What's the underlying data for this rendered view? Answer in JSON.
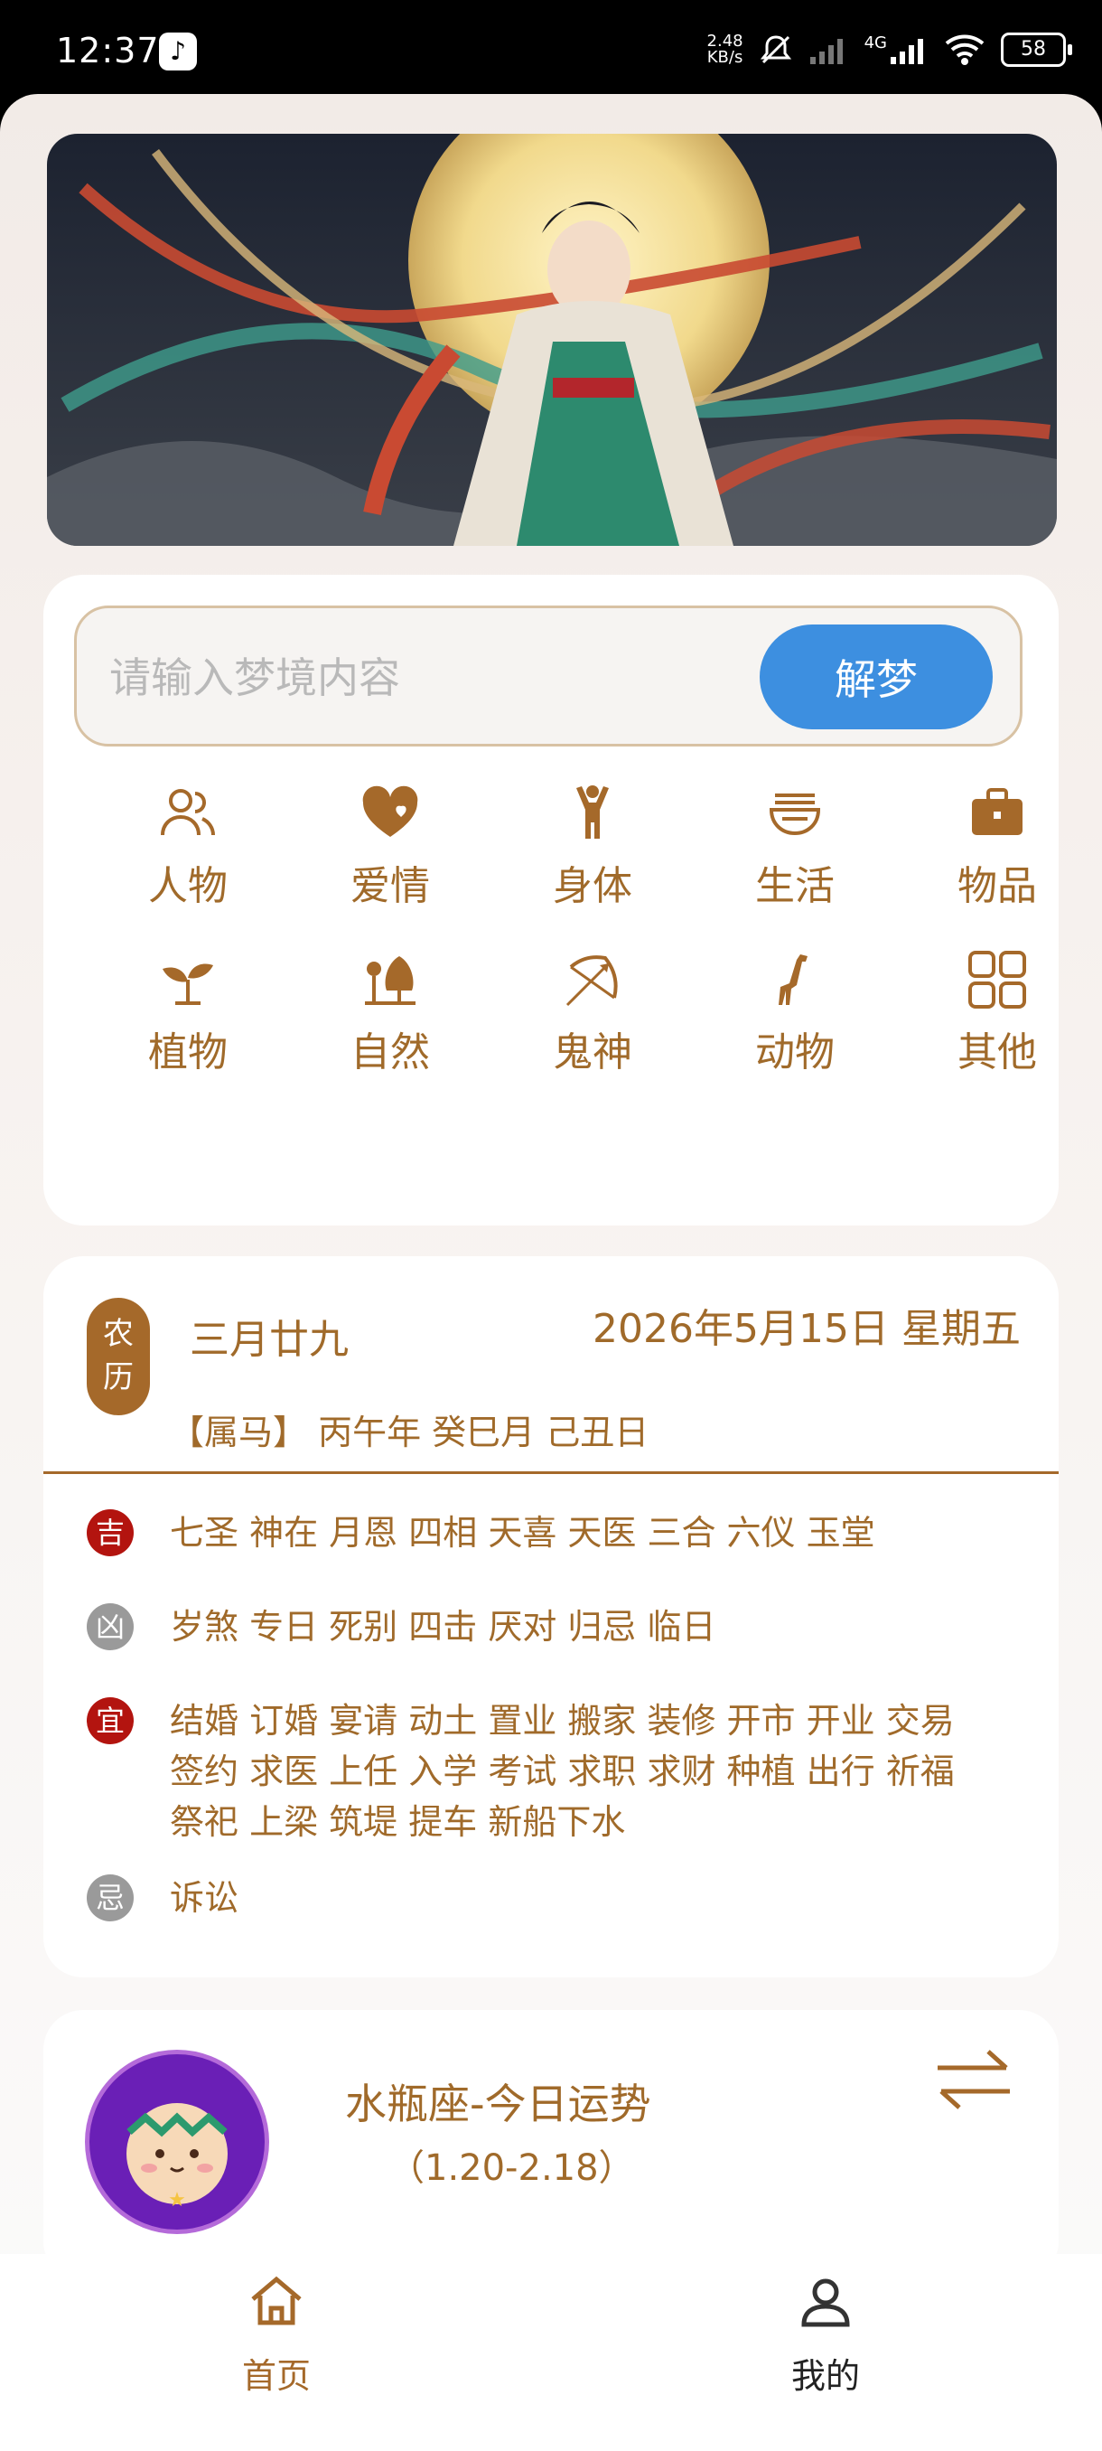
{
  "status_bar": {
    "time": "12:37",
    "app_icon": "tiktok-icon",
    "net_speed_value": "2.48",
    "net_speed_unit": "KB/s",
    "network": "4G",
    "battery": "58",
    "icons": [
      "mute-icon",
      "signal-x-icon",
      "signal-icon",
      "wifi-icon",
      "battery-icon"
    ]
  },
  "search": {
    "placeholder": "请输入梦境内容",
    "button_label": "解梦"
  },
  "categories": [
    {
      "label": "人物",
      "icon": "people-icon"
    },
    {
      "label": "爱情",
      "icon": "heart-icon"
    },
    {
      "label": "身体",
      "icon": "body-icon"
    },
    {
      "label": "生活",
      "icon": "bowl-icon"
    },
    {
      "label": "物品",
      "icon": "briefcase-icon"
    },
    {
      "label": "植物",
      "icon": "sprout-icon"
    },
    {
      "label": "自然",
      "icon": "tree-icon"
    },
    {
      "label": "鬼神",
      "icon": "bow-arrow-icon"
    },
    {
      "label": "动物",
      "icon": "giraffe-icon"
    },
    {
      "label": "其他",
      "icon": "grid-icon"
    }
  ],
  "calendar": {
    "badge_line1": "农",
    "badge_line2": "历",
    "lunar_date": "三月廿九",
    "solar_date": "2026年5月15日 星期五",
    "ganzhi": "【属马】 丙午年 癸巳月 己丑日",
    "lucky_tag": "吉",
    "lucky": "七圣 神在 月恩 四相 天喜 天医 三合 六仪 玉堂",
    "unlucky_tag": "凶",
    "unlucky": "岁煞 专日 死别 四击 厌对 归忌 临日",
    "suitable_tag": "宜",
    "suitable_line1": "结婚 订婚 宴请 动土 置业 搬家 装修 开市 开业 交易",
    "suitable_line2": "签约 求医 上任 入学 考试 求职 求财 种植 出行 祈福",
    "suitable_line3": "祭祀 上梁 筑堤 提车 新船下水",
    "avoid_tag": "忌",
    "avoid": "诉讼",
    "colors": {
      "accent": "#a5692a",
      "lucky": "#b3140f",
      "unlucky": "#9a9a9a"
    }
  },
  "zodiac": {
    "title": "水瓶座-今日运势",
    "range": "（1.20-2.18）",
    "icon": "swap-icon"
  },
  "tabbar": {
    "home_label": "首页",
    "mine_label": "我的"
  },
  "nav": {
    "icons": [
      "menu-icon",
      "home-square-icon",
      "back-icon"
    ]
  },
  "colors": {
    "primary": "#3d8fe0",
    "brown": "#a06a2a"
  }
}
